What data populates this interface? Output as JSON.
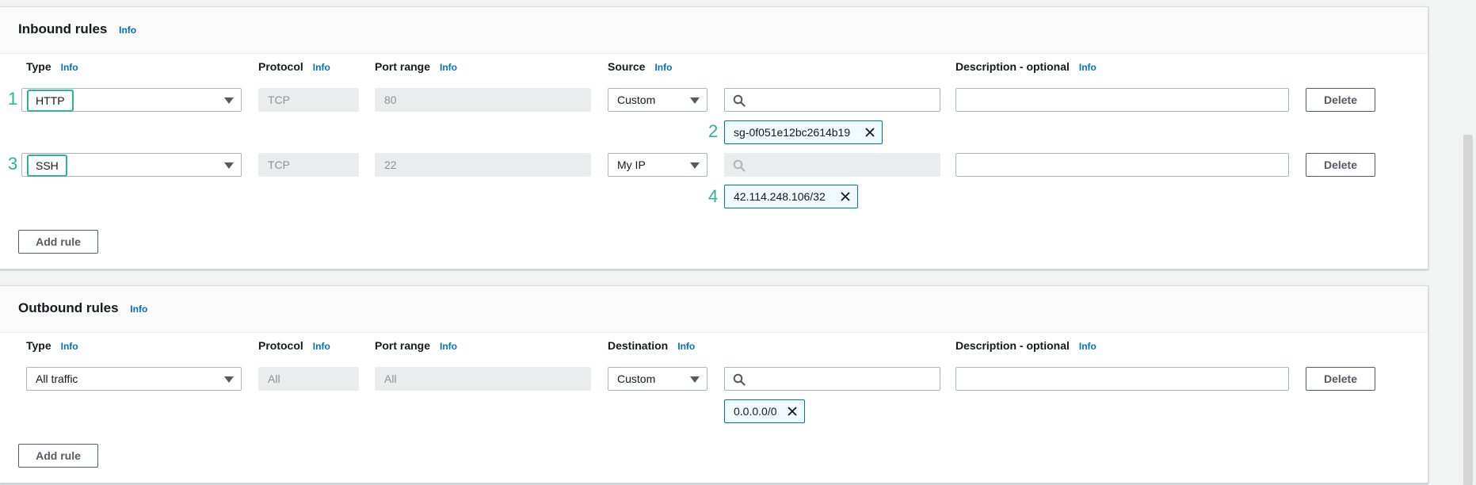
{
  "info_label": "Info",
  "inbound": {
    "title": "Inbound rules",
    "columns": {
      "type": "Type",
      "protocol": "Protocol",
      "port_range": "Port range",
      "source": "Source",
      "description": "Description - optional"
    },
    "rules": [
      {
        "marker": "1",
        "type": "HTTP",
        "protocol": "TCP",
        "port_range": "80",
        "source": "Custom",
        "search_placeholder": "",
        "token_marker": "2",
        "token": "sg-0f051e12bc2614b19",
        "delete_label": "Delete"
      },
      {
        "marker": "3",
        "type": "SSH",
        "protocol": "TCP",
        "port_range": "22",
        "source": "My IP",
        "search_placeholder": "",
        "token_marker": "4",
        "token": "42.114.248.106/32",
        "delete_label": "Delete"
      }
    ],
    "add_rule_label": "Add rule"
  },
  "outbound": {
    "title": "Outbound rules",
    "columns": {
      "type": "Type",
      "protocol": "Protocol",
      "port_range": "Port range",
      "destination": "Destination",
      "description": "Description - optional"
    },
    "rules": [
      {
        "type": "All traffic",
        "protocol": "All",
        "port_range": "All",
        "destination": "Custom",
        "token": "0.0.0.0/0",
        "delete_label": "Delete"
      }
    ],
    "add_rule_label": "Add rule"
  },
  "colors": {
    "accent": "#0073bb",
    "marker": "#2bb39b",
    "panel_bg": "#ffffff",
    "page_bg": "#f2f3f3"
  },
  "icons": {
    "search": "search-icon",
    "remove": "close-icon",
    "dropdown": "caret-down-icon"
  }
}
